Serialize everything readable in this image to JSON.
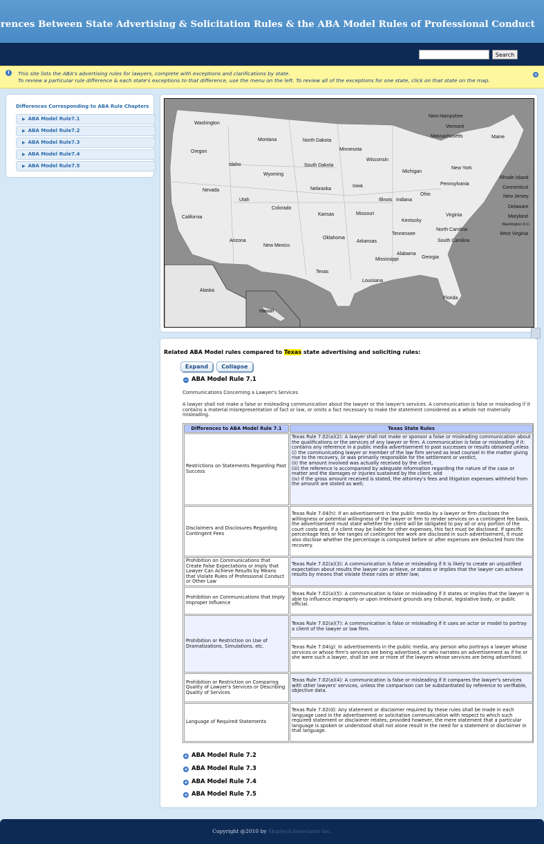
{
  "header": {
    "title": "Differences Between State Advertising & Solicitation Rules & the ABA Model Rules of Professional Conduct"
  },
  "search": {
    "placeholder": "",
    "button": "Search"
  },
  "notice": {
    "line1": "This site lists the ABA's advertising rules for lawyers, complete with exceptions and clarifications by state.",
    "line2": "To review a particular rule difference & each state's exceptions to that difference, use the menu on the left. To review all of the exceptions for one state, click on that state on the map."
  },
  "sidebar": {
    "title": "Differences Corresponding to ABA Rule Chapters",
    "items": [
      "ABA Model Rule7.1",
      "ABA Model Rule7.2",
      "ABA Model Rule7.3",
      "ABA Model Rule7.4",
      "ABA Model Rule7.5"
    ]
  },
  "map": {
    "states": [
      "Washington",
      "Oregon",
      "California",
      "Nevada",
      "Idaho",
      "Montana",
      "Wyoming",
      "Utah",
      "Arizona",
      "Colorado",
      "New Mexico",
      "North Dakota",
      "South Dakota",
      "Nebraska",
      "Kansas",
      "Oklahoma",
      "Texas",
      "Minnesota",
      "Iowa",
      "Missouri",
      "Arkansas",
      "Louisiana",
      "Wisconsin",
      "Illinois",
      "Michigan",
      "Indiana",
      "Ohio",
      "Kentucky",
      "Tennessee",
      "Mississippi",
      "Alabama",
      "Georgia",
      "Florida",
      "South Carolina",
      "North Carolina",
      "Virginia",
      "Pennsylvania",
      "New York",
      "Maine",
      "New Hampshire",
      "Vermont",
      "Massachusetts",
      "Rhode Island",
      "Connecticut",
      "New Jersey",
      "Delaware",
      "Maryland",
      "Washington D.C.",
      "West Virginia",
      "Alaska",
      "Hawaii"
    ]
  },
  "content": {
    "related_prefix": "Related ABA Model rules compared to",
    "state": "Texas",
    "related_suffix": "state advertising and soliciting rules:",
    "expand": "Expand",
    "collapse": "Collapse",
    "rule_open": "ABA Model Rule 7.1",
    "subtitle": "Communications Concerning a Lawyer's Services",
    "intro": "A lawyer shall not make a false or misleading communication about the lawyer or the lawyer's services. A communication is false or misleading if it contains a material misrepresentation of fact or law, or omits a fact necessary to make the statement considered as a whole not materially misleading.",
    "table": {
      "col1": "Differences to ABA Model Rule 7.1",
      "col2": "Texas State Rules",
      "rows": [
        {
          "label": "Restrictions on Statements Regarding Past Success",
          "text": "Texas Rule 7.02(a)(2): A lawyer shall not make or sponsor a false or misleading communication about the qualifications or the services of any lawyer or firm. A communication is false or misleading if it: contains any reference in a public media advertisement to past successes or results obtained unless\n(i) the communicating lawyer or member of the law firm served as lead counsel in the matter giving rise to the recovery, or was primarily responsible for the settlement or verdict,\n(ii) the amount involved was actually received by the client,\n(iii) the reference is accompanied by adequate information regarding the nature of the case or matter and the damages or injuries sustained by the client, and\n(iv) if the gross amount received is stated, the attorney's fees and litigation expenses withheld from the amount are stated as well;"
        },
        {
          "label": "Disclaimers and Disclosures Regarding Contingent Fees",
          "text": "Texas Rule 7.04(h): If an advertisement in the public media by a lawyer or firm discloses the willingness or potential willingness of the lawyer or firm to render services on a contingent fee basis, the advertisement must state whether the client will be obligated to pay all or any portion of the court costs and, if a client may be liable for other expenses, this fact must be disclosed. If specific percentage fees or fee ranges of contingent fee work are disclosed in such advertisement, it must also disclose whether the percentage is computed before or after expenses are deducted from the recovery."
        },
        {
          "label": "Prohibition on Communications that Create False Expectations or Imply that Lawyer Can Achieve Results by Means that Violate Rules of Professional Conduct or Other Law",
          "text": "Texas Rule 7.02(a)(3): A communication is false or misleading if it is likely to create an unjustified expectation about results the lawyer can achieve, or states or implies that the lawyer can achieve results by means that violate these rules or other law;"
        },
        {
          "label": "Prohibition on Communications that Imply Improper Influence",
          "text": "Texas Rule 7.02(a)(5): A communication is false or misleading if it states or implies that the lawyer is able to influence improperly or upon irrelevant grounds any tribunal, legislative body, or public official."
        },
        {
          "label": "Prohibition or Restriction on Use of Dramatizations, Simulations, etc.",
          "text": "Texas Rule 7.02(a)(7): A communication is false or misleading if it uses an actor or model to portray a client of the lawyer or law firm.",
          "text2": "Texas Rule 7.04(g): In advertisements in the public media, any person who portrays a lawyer whose services or whose firm's services are being advertised, or who narrates an advertisement as if he or she were such a lawyer, shall be one or more of the lawyers whose services are being advertised."
        },
        {
          "label": "Prohibition or Restriction on Comparing Quality of Lawyer's Services or Describing Quality of Services",
          "text": "Texas Rule 7.02(a)(4): A communication is false or misleading if it compares the lawyer's services with other lawyers' services, unless the comparison can be substantiated by reference to verifiable, objective data."
        },
        {
          "label": "Language of Required Statements",
          "text": "Texas Rule 7.02(d): Any statement or disclaimer required by these rules shall be made in each language used in the advertisement or solicitation communication with respect to which such required statement or disclaimer relates; provided however, the mere statement that a particular language is spoken or understood shall not alone result in the need for a statement or disclaimer in that language."
        }
      ]
    },
    "collapsed_rules": [
      "ABA Model Rule 7.2",
      "ABA Model Rule 7.3",
      "ABA Model Rule 7.4",
      "ABA Model Rule 7.5"
    ]
  },
  "footer": {
    "prefix": "Copyright @2010 by",
    "link": "Shipley&Associates Inc."
  }
}
